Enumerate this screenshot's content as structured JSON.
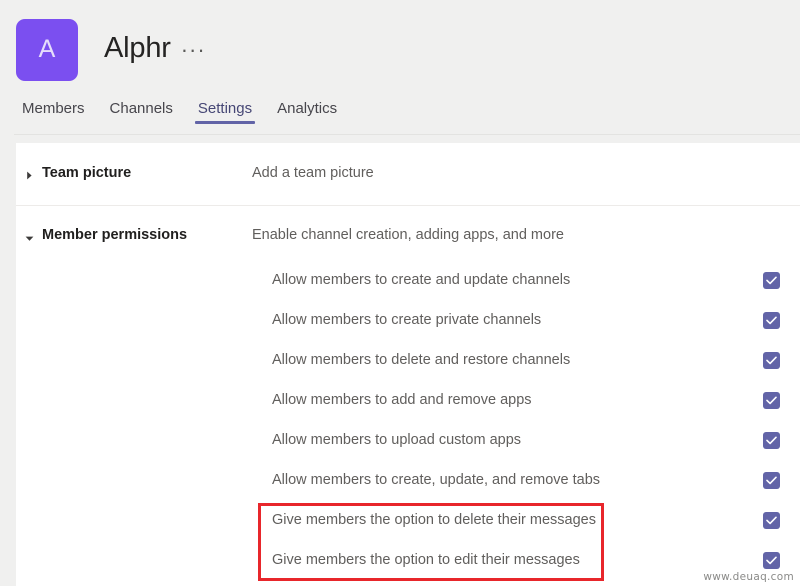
{
  "header": {
    "avatar_letter": "A",
    "team_name": "Alphr",
    "more_options": "···",
    "avatar_color": "#7b4ff0"
  },
  "tabs": [
    {
      "label": "Members",
      "active": false
    },
    {
      "label": "Channels",
      "active": false
    },
    {
      "label": "Settings",
      "active": true
    },
    {
      "label": "Analytics",
      "active": false
    }
  ],
  "accent_color": "#6264a7",
  "sections": [
    {
      "title": "Team picture",
      "description": "Add a team picture",
      "expanded": false
    },
    {
      "title": "Member permissions",
      "description": "Enable channel creation, adding apps, and more",
      "expanded": true
    }
  ],
  "permissions": [
    {
      "label": "Allow members to create and update channels",
      "checked": true
    },
    {
      "label": "Allow members to create private channels",
      "checked": true
    },
    {
      "label": "Allow members to delete and restore channels",
      "checked": true
    },
    {
      "label": "Allow members to add and remove apps",
      "checked": true
    },
    {
      "label": "Allow members to upload custom apps",
      "checked": true
    },
    {
      "label": "Allow members to create, update, and remove tabs",
      "checked": true
    },
    {
      "label": "Give members the option to delete their messages",
      "checked": true
    },
    {
      "label": "Give members the option to edit their messages",
      "checked": true
    }
  ],
  "annotation": {
    "highlight_color": "#e8262b"
  },
  "watermark": {
    "text": "www.deuaq.com"
  }
}
